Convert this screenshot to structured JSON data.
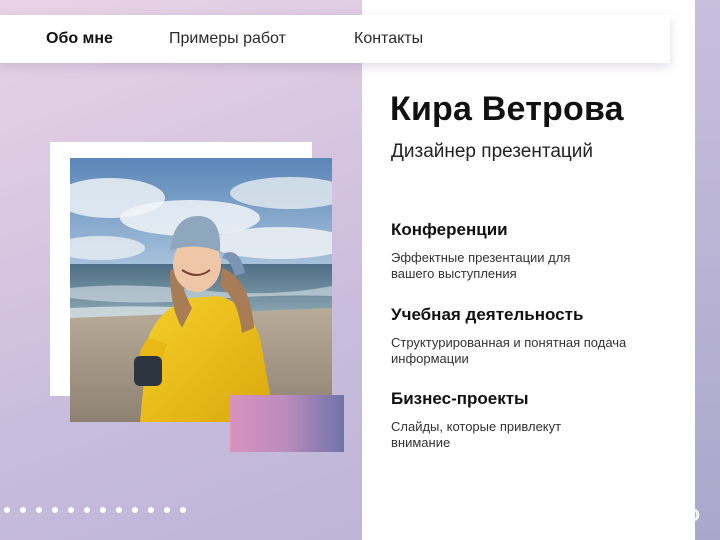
{
  "nav": {
    "items": [
      {
        "label": "Обо мне",
        "active": true
      },
      {
        "label": "Примеры работ",
        "active": false
      },
      {
        "label": "Контакты",
        "active": false
      }
    ]
  },
  "hero": {
    "name": "Кира Ветрова",
    "role": "Дизайнер презентаций"
  },
  "services": [
    {
      "title": "Конференции",
      "description": "Эффектные презентации для вашего выступления"
    },
    {
      "title": "Учебная деятельность",
      "description": "Структурированная и понятная подача информации"
    },
    {
      "title": "Бизнес-проекты",
      "description": "Слайды, которые привлекут внимание"
    }
  ],
  "watermark": {
    "text": "Avito",
    "icon": "avito-logo-icon"
  },
  "colors": {
    "accent_pink": "#d892bf",
    "accent_blue": "#6f74a8",
    "jacket_yellow": "#f2c418"
  }
}
